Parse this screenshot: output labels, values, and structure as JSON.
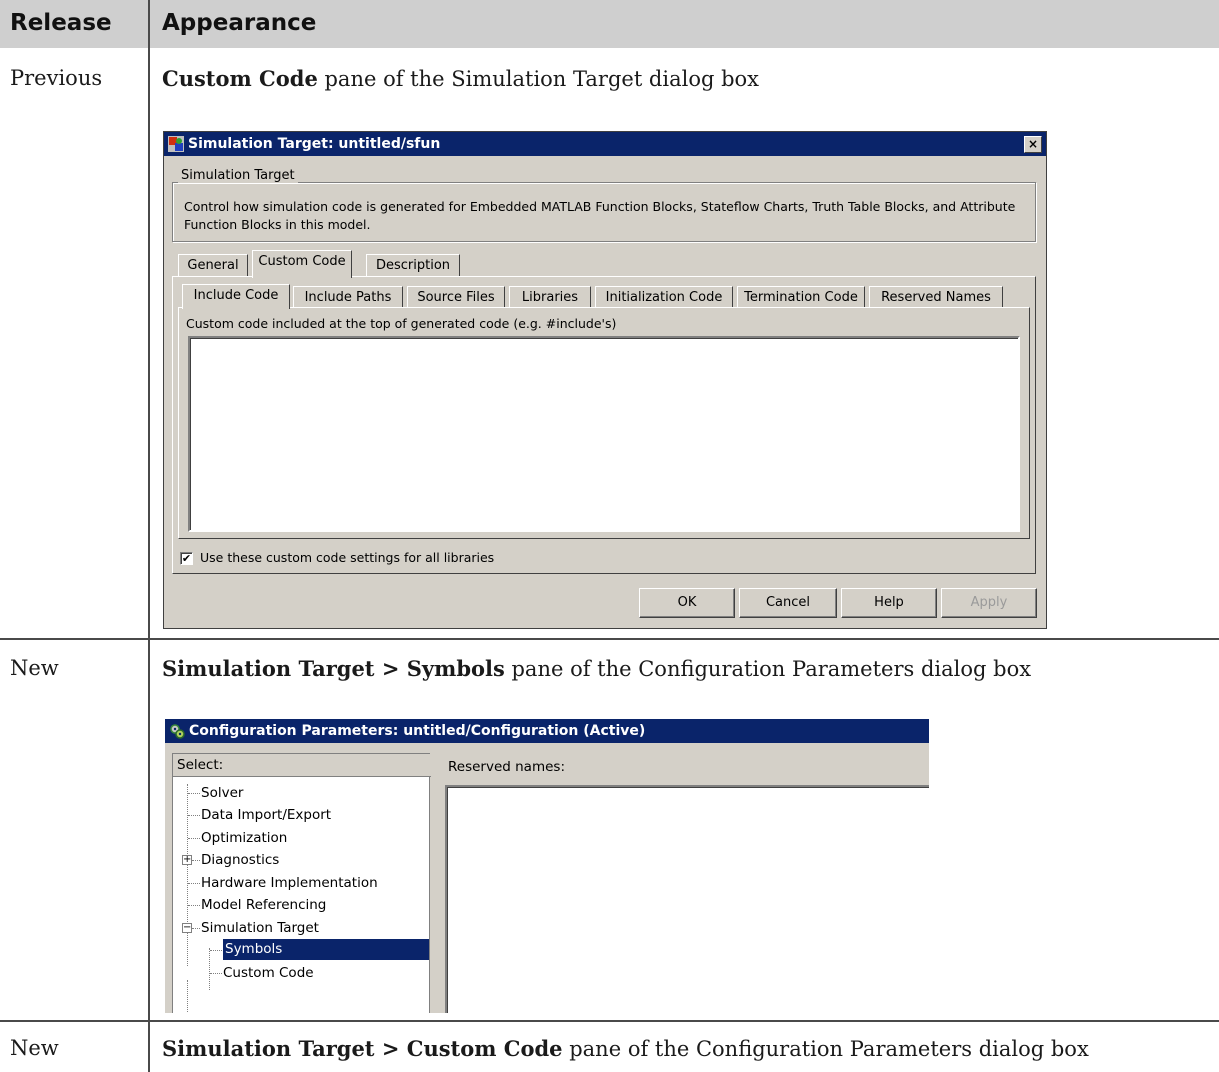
{
  "table": {
    "headers": {
      "release": "Release",
      "appearance": "Appearance"
    },
    "rows": [
      {
        "release": "Previous",
        "appearance_bold": "Custom Code",
        "appearance_rest": " pane of the Simulation Target dialog box"
      },
      {
        "release": "New",
        "appearance_bold": "Simulation Target > Symbols",
        "appearance_rest": " pane of the Configuration Parameters dialog box"
      },
      {
        "release": "New",
        "appearance_bold": "Simulation Target > Custom Code",
        "appearance_rest": " pane of the Configuration Parameters dialog box"
      }
    ]
  },
  "dialog1": {
    "title": "Simulation Target: untitled/sfun",
    "close_label": "×",
    "group_label": "Simulation Target",
    "description": "Control how simulation code is generated for Embedded MATLAB Function Blocks, Stateflow Charts, Truth Table Blocks, and Attribute Function Blocks in this model.",
    "tabs": [
      "General",
      "Custom Code",
      "Description"
    ],
    "subtabs": [
      "Include Code",
      "Include Paths",
      "Source Files",
      "Libraries",
      "Initialization Code",
      "Termination Code",
      "Reserved Names"
    ],
    "field_label": "Custom code included at the top of generated code (e.g. #include's)",
    "field_value": "",
    "checkbox_label": "Use these custom code settings for all libraries",
    "checkbox_checked": true,
    "buttons": {
      "ok": "OK",
      "cancel": "Cancel",
      "help": "Help",
      "apply": "Apply"
    }
  },
  "dialog2": {
    "title": "Configuration Parameters: untitled/Configuration (Active)",
    "select_label": "Select:",
    "tree": [
      "Solver",
      "Data Import/Export",
      "Optimization",
      "Diagnostics",
      "Hardware Implementation",
      "Model Referencing",
      "Simulation Target",
      "Symbols",
      "Custom Code"
    ],
    "selected": "Symbols",
    "reserved_label": "Reserved names:",
    "reserved_value": ""
  },
  "colors": {
    "titlebar": "#0a246a",
    "dialog_face": "#d4d0c8",
    "header_bg": "#cfcfcf",
    "selection": "#0a246a"
  }
}
